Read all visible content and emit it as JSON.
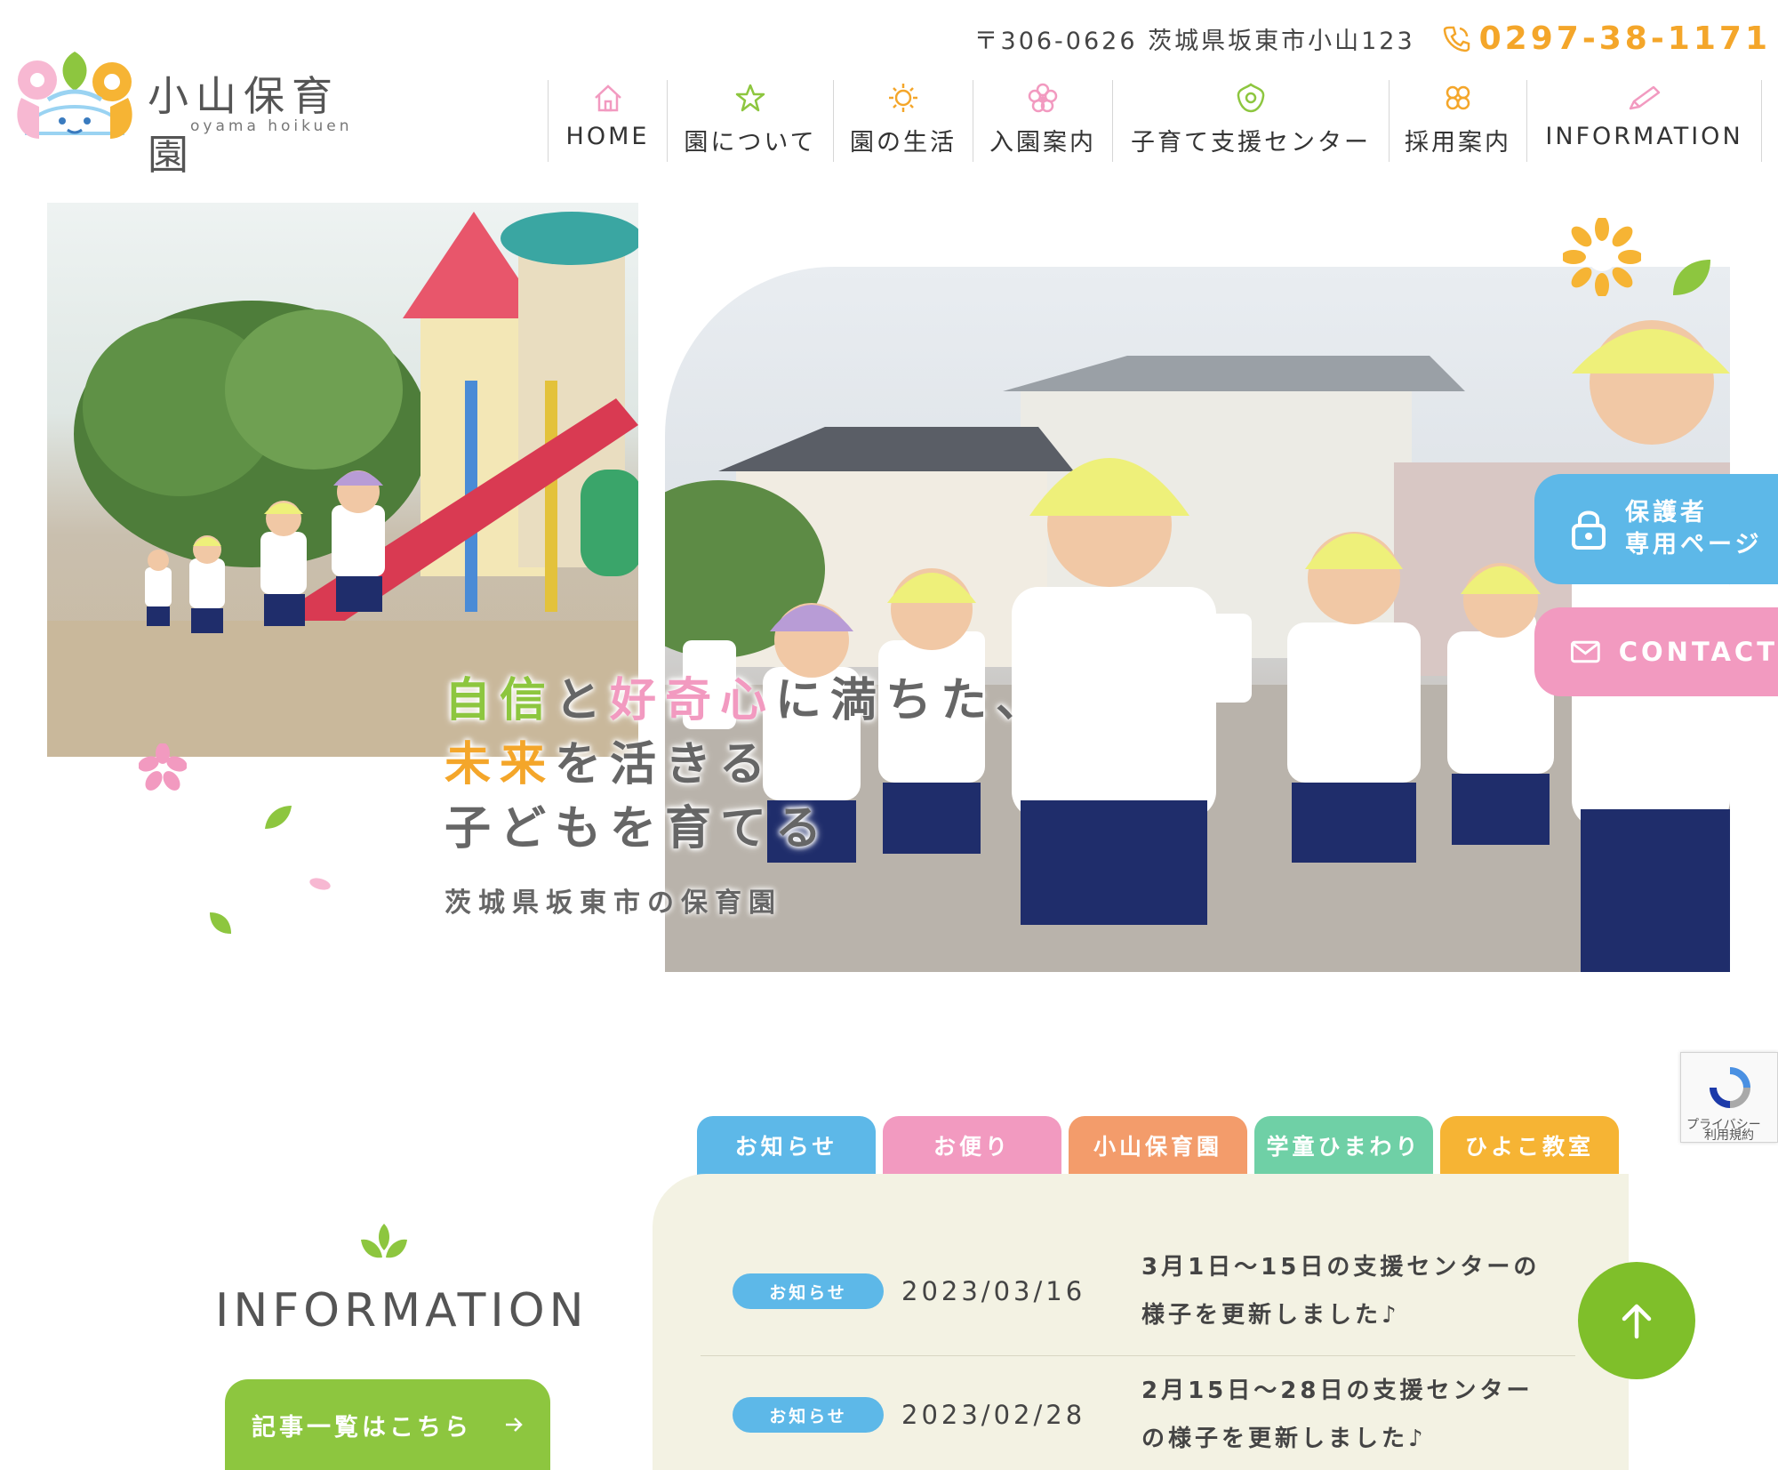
{
  "header": {
    "logo_name": "小山保育園",
    "logo_roman": "oyama hoikuen",
    "address": "〒306-0626 茨城県坂東市小山123",
    "phone": "0297-38-1171"
  },
  "nav": {
    "items": [
      {
        "label": "HOME",
        "icon": "house-icon",
        "color": "#f29ac0"
      },
      {
        "label": "園について",
        "icon": "star-icon",
        "color": "#8dc63f"
      },
      {
        "label": "園の生活",
        "icon": "sun-icon",
        "color": "#f4a62a"
      },
      {
        "label": "入園案内",
        "icon": "flower-icon",
        "color": "#f29ac0"
      },
      {
        "label": "子育て支援センター",
        "icon": "blossom-icon",
        "color": "#8dc63f"
      },
      {
        "label": "採用案内",
        "icon": "clover-icon",
        "color": "#f4a62a"
      },
      {
        "label": "INFORMATION",
        "icon": "pencil-icon",
        "color": "#f29ac0"
      }
    ]
  },
  "hero": {
    "line1_a": "自信",
    "line1_b": "と",
    "line1_c": "好奇心",
    "line1_d": "に満ちた、",
    "line2_a": "未来",
    "line2_b": "を活きる",
    "line3": "子どもを育てる",
    "sub": "茨城県坂東市の保育園"
  },
  "side": {
    "guardian_line1": "保護者",
    "guardian_line2": "専用ページ",
    "contact": "CONTACT"
  },
  "recaptcha": {
    "line1": "プライバシー",
    "line2": "利用規約"
  },
  "info": {
    "title": "INFORMATION",
    "all_button": "記事一覧はこちら",
    "tabs": [
      {
        "label": "お知らせ",
        "color": "#5db8e8"
      },
      {
        "label": "お便り",
        "color": "#f29ac0"
      },
      {
        "label": "小山保育園",
        "color": "#f39c6b"
      },
      {
        "label": "学童ひまわり",
        "color": "#6fd0a6"
      },
      {
        "label": "ひよこ教室",
        "color": "#f6b434"
      }
    ],
    "news": [
      {
        "badge": "お知らせ",
        "date": "2023/03/16",
        "title": "3月1日～15日の支援センターの様子を更新しました♪"
      },
      {
        "badge": "お知らせ",
        "date": "2023/02/28",
        "title": "2月15日～28日の支援センターの様子を更新しました♪"
      }
    ]
  },
  "colors": {
    "green": "#8dc63f",
    "pink": "#f29ac0",
    "orange": "#f4a62a",
    "blue": "#5db8e8",
    "cream": "#f3f2e3"
  }
}
